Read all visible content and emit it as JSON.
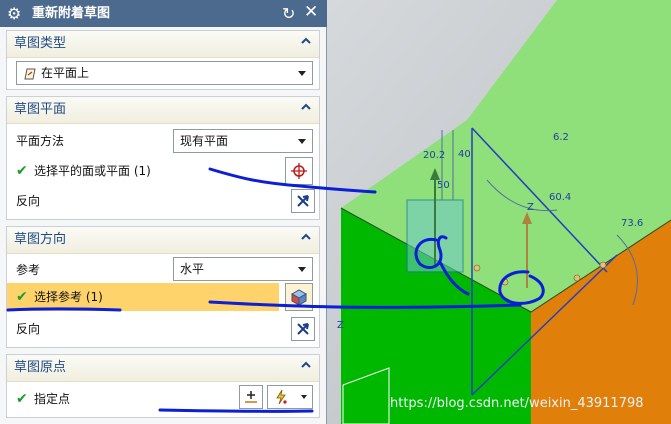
{
  "dialog": {
    "title": "重新附着草图",
    "icons": {
      "settings": "gear-icon",
      "reset": "reset-icon",
      "close": "close-icon"
    }
  },
  "sketch_type": {
    "header": "草图类型",
    "selected": "在平面上"
  },
  "sketch_plane": {
    "header": "草图平面",
    "method_label": "平面方法",
    "method_value": "现有平面",
    "select_label": "选择平的面或平面 (1)",
    "reverse_label": "反向"
  },
  "sketch_orientation": {
    "header": "草图方向",
    "reference_label": "参考",
    "reference_value": "水平",
    "select_label": "选择参考 (1)",
    "reverse_label": "反向"
  },
  "sketch_origin": {
    "header": "草图原点",
    "point_label": "指定点"
  },
  "viewport": {
    "dims": [
      "20.2",
      "50",
      "40",
      "6.2",
      "60.4",
      "73.6"
    ],
    "axis": "Z"
  },
  "watermark": "https://blog.csdn.net/weixin_43911798",
  "colors": {
    "titlebar": "#4b6a8e",
    "section_header_text": "#1f4a86",
    "highlight": "#ffd36b",
    "check": "#1a9c2a",
    "green_face": "#00b800",
    "orange_face": "#e07f0a",
    "annotation": "#0a1fd6"
  }
}
